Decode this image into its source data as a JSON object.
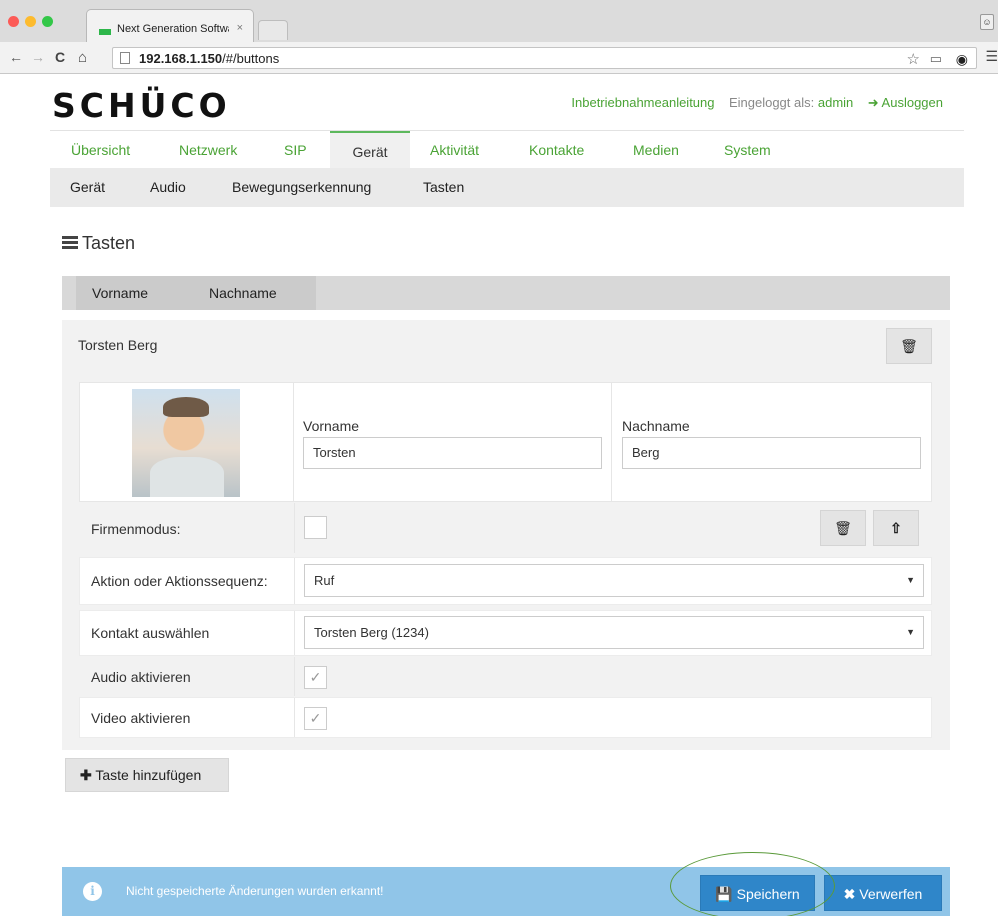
{
  "browser": {
    "tab_title": "Next Generation Software",
    "tab_close": "×",
    "url_host": "192.168.1.150",
    "url_path": "/#/buttons",
    "nav": {
      "back": "←",
      "forward": "→",
      "reload": "C",
      "home": "⌂"
    }
  },
  "colors": {
    "brand_green": "#4aa335",
    "alert_blue": "#90c5e8",
    "button_blue": "#2f86c9"
  },
  "header": {
    "logo": "SCHÜCO",
    "guide_link": "Inbetriebnahmeanleitung",
    "logged_in_label": "Eingeloggt als:",
    "username": "admin",
    "logout": "Ausloggen"
  },
  "main_nav": [
    "Übersicht",
    "Netzwerk",
    "SIP",
    "Gerät",
    "Aktivität",
    "Kontakte",
    "Medien",
    "System"
  ],
  "main_nav_active": "Gerät",
  "sub_nav": [
    "Gerät",
    "Audio",
    "Bewegungserkennung",
    "Tasten"
  ],
  "sub_nav_active": "Tasten",
  "section_title": "Tasten",
  "columns": [
    "Vorname",
    "Nachname"
  ],
  "entry": {
    "title": "Torsten Berg",
    "firstname_label": "Vorname",
    "firstname_value": "Torsten",
    "lastname_label": "Nachname",
    "lastname_value": "Berg",
    "company_mode_label": "Firmenmodus:",
    "company_mode_checked": false,
    "action_label": "Aktion oder Aktionssequenz:",
    "action_value": "Ruf",
    "contact_label": "Kontakt auswählen",
    "contact_value": "Torsten Berg (1234)",
    "audio_label": "Audio aktivieren",
    "audio_checked": true,
    "video_label": "Video aktivieren",
    "video_checked": true
  },
  "add_button": "Taste hinzufügen",
  "alert": {
    "message": "Nicht gespeicherte Änderungen wurden erkannt!",
    "save": "Speichern",
    "discard": "Verwerfen"
  },
  "icons": [
    "trash-icon",
    "upload-icon",
    "info-icon",
    "save-icon",
    "close-icon",
    "plus-icon",
    "list-icon",
    "logout-icon",
    "star-icon"
  ]
}
